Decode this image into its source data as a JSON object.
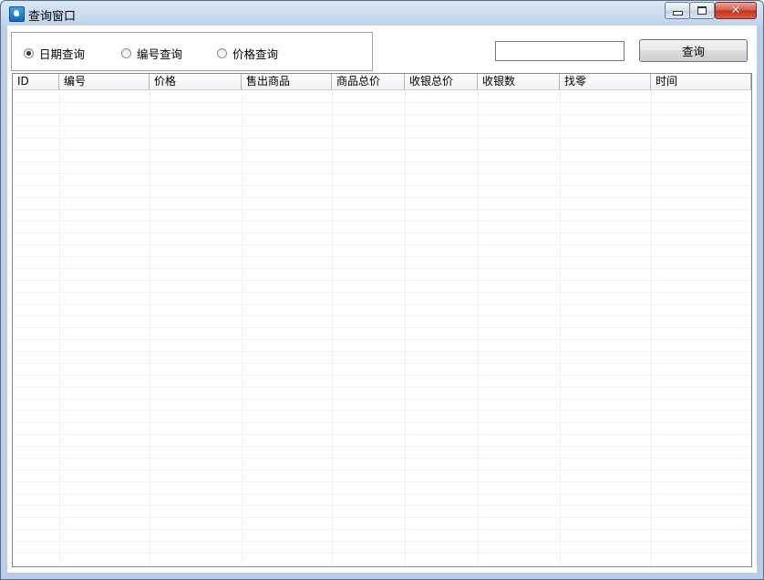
{
  "window": {
    "title": "查询窗口",
    "close_glyph": "✕"
  },
  "query_options": [
    {
      "label": "日期查询",
      "checked": true
    },
    {
      "label": "编号查询",
      "checked": false
    },
    {
      "label": "价格查询",
      "checked": false
    }
  ],
  "search": {
    "value": "",
    "button_label": "查询"
  },
  "table": {
    "columns": [
      "ID",
      "编号",
      "价格",
      "售出商品",
      "商品总价",
      "收银总价",
      "收银数",
      "找零",
      "时间"
    ],
    "rows": []
  }
}
